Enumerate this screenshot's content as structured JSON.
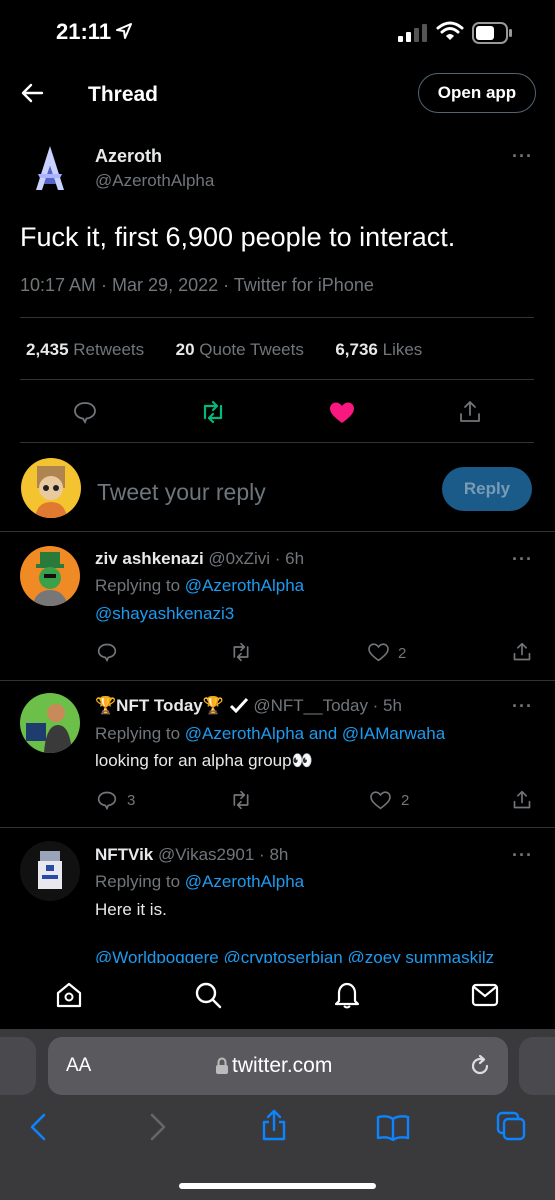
{
  "status": {
    "time": "21:11"
  },
  "header": {
    "title": "Thread",
    "open_app": "Open app"
  },
  "tweet": {
    "author_name": "Azeroth",
    "handle": "@AzerothAlpha",
    "text": "Fuck it, first 6,900 people to interact.",
    "meta": "10:17 AM · Mar 29, 2022 · Twitter for iPhone",
    "retweets_count": "2,435",
    "retweets_label": "Retweets",
    "quotes_count": "20",
    "quotes_label": "Quote Tweets",
    "likes_count": "6,736",
    "likes_label": "Likes"
  },
  "composer": {
    "placeholder": "Tweet your reply",
    "reply_label": "Reply"
  },
  "replies": [
    {
      "name": "ziv ashkenazi",
      "handle_time": "@0xZivi · 6h",
      "replying_prefix": "Replying to",
      "replying_to": "@AzerothAlpha",
      "body": "@shayashkenazi3",
      "likes": "2"
    },
    {
      "name": "🏆NFT Today🏆",
      "handle_time": "@NFT__Today · 5h",
      "replying_prefix": "Replying to",
      "replying_to": "@AzerothAlpha and @IAMarwaha",
      "body": "looking for an alpha group👀",
      "replies": "3",
      "likes": "2"
    },
    {
      "name": "NFTVik",
      "handle_time": "@Vikas2901 · 8h",
      "replying_prefix": "Replying to",
      "replying_to": "@AzerothAlpha",
      "body": "Here it is.",
      "mentions": "@Worldpoggere @cryptoserbian @zoey summaskilz"
    }
  ],
  "safari": {
    "aa": "AA",
    "url": "twitter.com"
  },
  "colors": {
    "accent": "#1d9bf0",
    "like": "#f91880",
    "retweet": "#00ba7c",
    "muted": "#71767b"
  }
}
